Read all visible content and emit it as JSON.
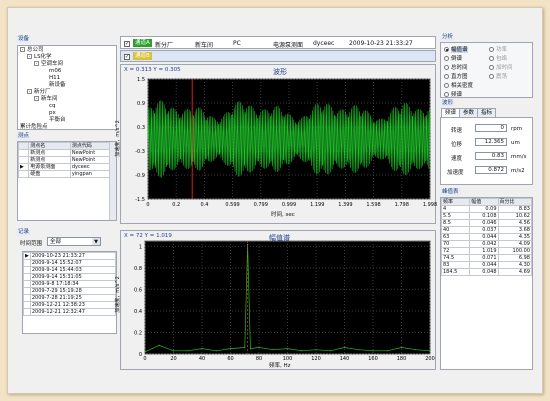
{
  "colors": {
    "wave": "#1fbf2a",
    "marker": "#ff2a2a",
    "axis": "#dfe4ea",
    "select": "#1e3e8e"
  },
  "equipment": {
    "title": "设备",
    "tree": [
      "总公司",
      "LS化学",
      "空调车间",
      "m06",
      "H11",
      "新设备",
      "新分厂",
      "新车间",
      "cq",
      "px",
      "平衡台",
      "累计危险点"
    ]
  },
  "points": {
    "title": "测点",
    "headers": [
      "测点名",
      "测点代码"
    ],
    "rows": [
      [
        "新测点",
        "NewPoint"
      ],
      [
        "新测点",
        "NewPoint"
      ],
      [
        "电源泵测面",
        "dyceec"
      ],
      [
        "硬盘",
        "yingpan"
      ]
    ]
  },
  "records": {
    "title": "记录",
    "range_label": "时间范围",
    "range_value": "全部",
    "items": [
      "2009-10-23 21:33:27",
      "2009-9-14 15:52:07",
      "2009-9-14 15:44:03",
      "2009-9-14 15:31:05",
      "2009-9-8 17:18:34",
      "2009-7-29 15:19:28",
      "2009-7-28 21:19:25",
      "2009-12-21 12:38:23",
      "2009-12-21 12:32:47"
    ]
  },
  "info_row": {
    "badge1": "通道A",
    "badge2": "通道B",
    "factory": "新分厂",
    "workshop": "新车间",
    "device": "PC",
    "point": "电源泵测面",
    "code": "dyceec",
    "time": "2009-10-23 21:33:27"
  },
  "waveform": {
    "readout": "X = 0.313  Y = 0.305",
    "title": "波形",
    "ylabel": "加速度，m/s^2",
    "xlabel": "时间, sec",
    "xticks": [
      "0",
      "0.2",
      "0.4",
      "0.599",
      "0.799",
      "0.999",
      "1.199",
      "1.399",
      "1.598",
      "1.798",
      "1.998"
    ],
    "yticks": [
      "1.5",
      "0.9",
      "0.3",
      "-0.3",
      "-0.9",
      "-1.5"
    ],
    "marker_x": 0.313
  },
  "spectrum": {
    "readout": "X = 72  Y = 1.019",
    "title": "幅值谱",
    "ylabel": "加速度，m/s^2",
    "xlabel": "频率, Hz",
    "xticks": [
      "0",
      "20",
      "40",
      "60",
      "80",
      "100",
      "120",
      "140",
      "160",
      "180",
      "200"
    ],
    "yticks": [
      "1",
      "0.8",
      "0.6",
      "0.4",
      "0.2",
      "0"
    ],
    "marker_x": 72
  },
  "chart_data": [
    {
      "type": "line",
      "title": "波形",
      "xlabel": "时间, sec",
      "ylabel": "加速度，m/s^2",
      "xlim": [
        0,
        1.998
      ],
      "ylim": [
        -1.5,
        1.5
      ],
      "series": [
        {
          "amplitude": 1.0,
          "dominant_frequency_hz": 72
        }
      ]
    },
    {
      "type": "line",
      "title": "幅值谱",
      "xlabel": "频率, Hz",
      "ylabel": "加速度，m/s^2",
      "xlim": [
        0,
        200
      ],
      "ylim": [
        0,
        1.05
      ],
      "series": [
        {
          "x": [
            0,
            10,
            20,
            30,
            40,
            50,
            60,
            70,
            72,
            74,
            80,
            90,
            100,
            110,
            120,
            130,
            140,
            150,
            160,
            170,
            180,
            190,
            200
          ],
          "y": [
            0.02,
            0.08,
            0.03,
            0.03,
            0.05,
            0.03,
            0.05,
            0.06,
            1.019,
            0.05,
            0.06,
            0.04,
            0.05,
            0.03,
            0.04,
            0.03,
            0.06,
            0.04,
            0.03,
            0.03,
            0.06,
            0.04,
            0.03
          ]
        }
      ]
    }
  ],
  "analysis": {
    "title": "分析",
    "options": [
      [
        "幅值谱",
        "功率"
      ],
      [
        "倒谱",
        "包络"
      ],
      [
        "总时间",
        "加时间"
      ],
      [
        "直方图",
        "震荡"
      ],
      [
        "相关密度",
        ""
      ],
      [
        "频谱",
        ""
      ]
    ]
  },
  "params": {
    "title": "波形",
    "tabs": [
      "频谱",
      "参数",
      "指标"
    ],
    "rows": [
      [
        "转速",
        "0",
        "rpm"
      ],
      [
        "位移",
        "12.365",
        "um"
      ],
      [
        "速度",
        "0.83",
        "mm/s"
      ],
      [
        "加速度",
        "0.872",
        "m/s2"
      ]
    ]
  },
  "peaks": {
    "title": "峰值表",
    "headers": [
      "频率",
      "幅值",
      "百分比"
    ],
    "rows": [
      [
        "4",
        "0.09",
        "8.83"
      ],
      [
        "5.5",
        "0.108",
        "10.62"
      ],
      [
        "8.5",
        "0.046",
        "4.56"
      ],
      [
        "40",
        "0.037",
        "3.68"
      ],
      [
        "63",
        "0.044",
        "4.35"
      ],
      [
        "70",
        "0.042",
        "4.09"
      ],
      [
        "72",
        "1.019",
        "100.00"
      ],
      [
        "74.5",
        "0.071",
        "6.98"
      ],
      [
        "83",
        "0.044",
        "4.30"
      ],
      [
        "184.5",
        "0.048",
        "4.69"
      ]
    ]
  }
}
